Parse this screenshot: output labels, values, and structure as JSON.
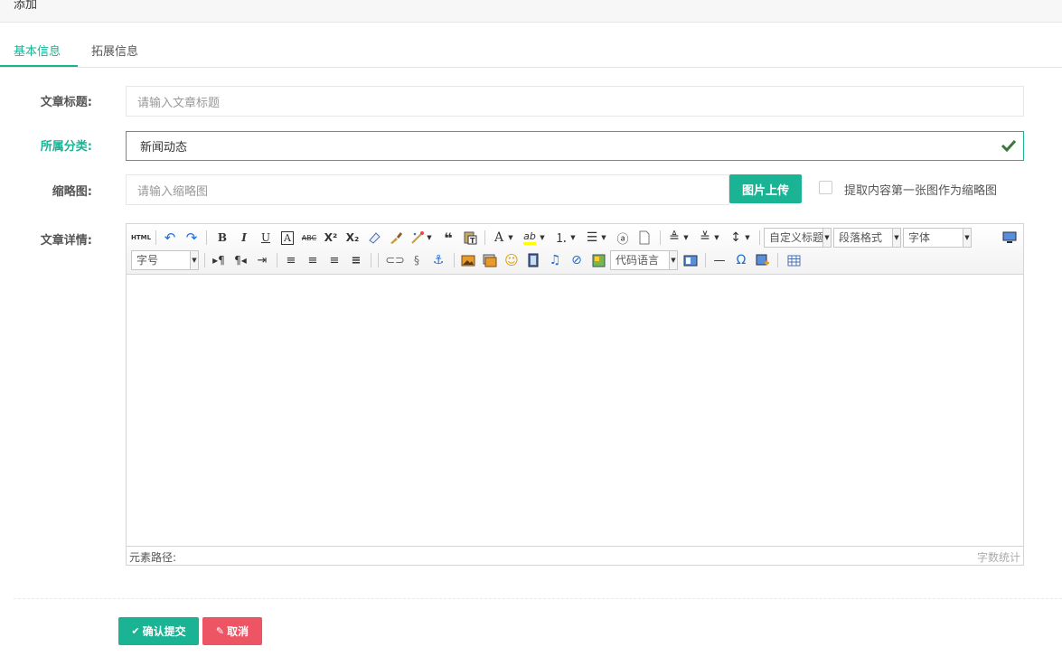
{
  "header": {
    "title": "添加"
  },
  "tabs": [
    {
      "label": "基本信息",
      "active": true
    },
    {
      "label": "拓展信息",
      "active": false
    }
  ],
  "form": {
    "title": {
      "label": "文章标题:",
      "placeholder": "请输入文章标题",
      "value": ""
    },
    "category": {
      "label": "所属分类:",
      "value": "新闻动态"
    },
    "thumbnail": {
      "label": "缩略图:",
      "placeholder": "请输入缩略图",
      "value": ""
    },
    "upload_button": "图片上传",
    "extract_checkbox": {
      "label": "提取内容第一张图作为缩略图",
      "checked": false
    },
    "content": {
      "label": "文章详情:"
    }
  },
  "editor": {
    "toolbar": {
      "html": "HTML",
      "custom_title": "自定义标题",
      "paragraph": "段落格式",
      "font": "字体",
      "font_size": "字号",
      "code_lang": "代码语言"
    },
    "status": {
      "path_label": "元素路径:",
      "word_count": "字数统计"
    }
  },
  "actions": {
    "submit": "确认提交",
    "cancel": "取消"
  },
  "colors": {
    "accent": "#1ab394",
    "danger": "#ed5565"
  }
}
